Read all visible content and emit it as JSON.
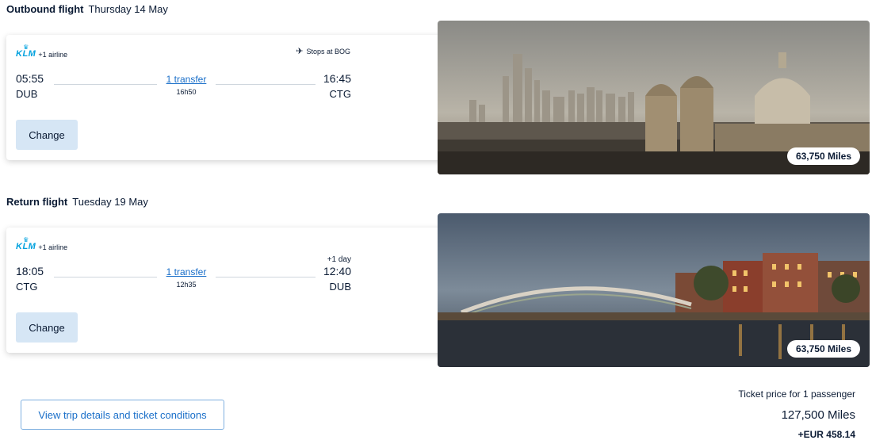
{
  "outbound": {
    "heading": "Outbound flight",
    "date": "Thursday 14 May",
    "airline_logo_text": "KLM",
    "airline_extra": "+1 airline",
    "stops": "Stops at BOG",
    "departure_time": "05:55",
    "departure_code": "DUB",
    "arrival_time": "16:45",
    "arrival_code": "CTG",
    "transfer": "1 transfer",
    "duration": "16h50",
    "change_label": "Change",
    "miles": "63,750 Miles"
  },
  "return": {
    "heading": "Return flight",
    "date": "Tuesday 19 May",
    "airline_logo_text": "KLM",
    "airline_extra": "+1 airline",
    "departure_time": "18:05",
    "departure_code": "CTG",
    "arrival_time": "12:40",
    "arrival_code": "DUB",
    "plus_day": "+1 day",
    "transfer": "1 transfer",
    "duration": "12h35",
    "change_label": "Change",
    "miles": "63,750 Miles"
  },
  "footer": {
    "view_details_label": "View trip details and ticket conditions",
    "price_label": "Ticket price for 1 passenger",
    "price_miles": "127,500 Miles",
    "price_eur": "+EUR 458.14"
  },
  "colors": {
    "brand": "#00a1de",
    "link": "#1a6fc9",
    "button_bg": "#d6e6f5"
  },
  "icons": {
    "airline": "klm-crown-icon",
    "stops": "airplane-icon"
  }
}
